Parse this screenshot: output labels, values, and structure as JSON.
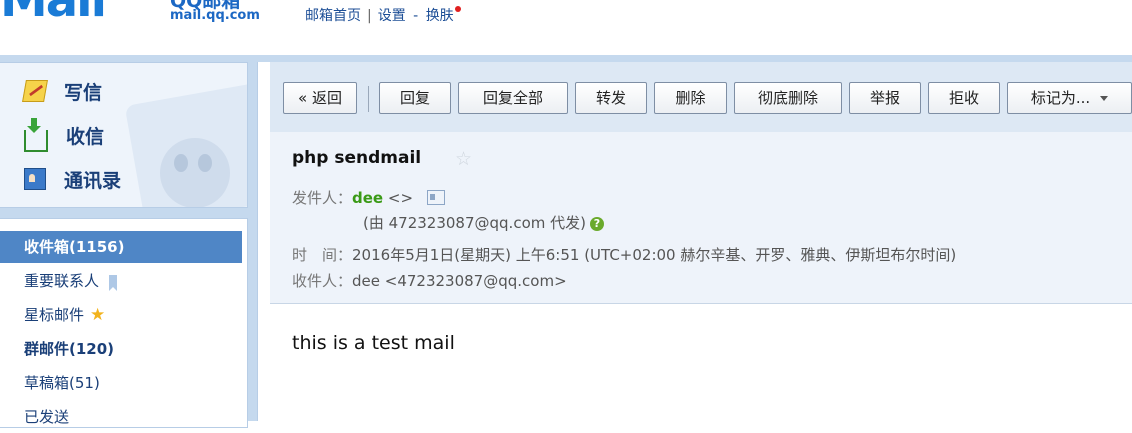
{
  "header": {
    "logo_word": "Mail",
    "logo_product": "QQ邮箱",
    "logo_domain": "mail.qq.com",
    "links": {
      "home": "邮箱首页",
      "settings": "设置",
      "dash": "-",
      "skin": "换肤",
      "sep": "|"
    }
  },
  "actions": {
    "write": "写信",
    "receive": "收信",
    "contacts": "通讯录"
  },
  "folders": [
    {
      "label": "收件箱(1156)"
    },
    {
      "label": "重要联系人"
    },
    {
      "label": "星标邮件"
    },
    {
      "label": "群邮件(120)"
    },
    {
      "label": "草稿箱(51)"
    },
    {
      "label": "已发送"
    }
  ],
  "toolbar": {
    "back": "« 返回",
    "reply": "回复",
    "reply_all": "回复全部",
    "forward": "转发",
    "delete": "删除",
    "delete_perm": "彻底删除",
    "report": "举报",
    "reject": "拒收",
    "mark_as": "标记为..."
  },
  "mail": {
    "subject": "php sendmail",
    "star": "☆",
    "from_label": "发件人：",
    "from_name": "dee",
    "from_addr": "<>",
    "proxy": "(由 472323087@qq.com 代发)",
    "time_label": "时　间：",
    "time": "2016年5月1日(星期天) 上午6:51 (UTC+02:00 赫尔辛基、开罗、雅典、伊斯坦布尔时间)",
    "to_label": "收件人：",
    "to": "dee <472323087@qq.com>",
    "body": "this is a test mail"
  },
  "colors": {
    "accent": "#4f86c6",
    "sender": "#3a9a16",
    "link": "#1c4e96"
  }
}
